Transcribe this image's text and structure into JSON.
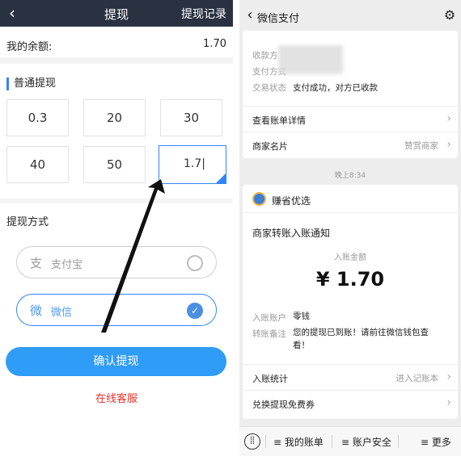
{
  "left": {
    "header": {
      "back_icon": "chevron-left-icon",
      "title": "提现",
      "records": "提现记录",
      "bg": "#2a3242"
    },
    "balance": {
      "label": "我的余额:",
      "value": "1.70"
    },
    "section_normal": "普通提现",
    "amounts": [
      "0.3",
      "20",
      "30",
      "40",
      "50"
    ],
    "custom_amount": "1.7",
    "method_title": "提现方式",
    "methods": [
      {
        "icon": "alipay-icon",
        "glyph": "支",
        "name": "支付宝",
        "selected": false
      },
      {
        "icon": "wechat-icon",
        "glyph": "微",
        "name": "微信",
        "selected": true
      }
    ],
    "confirm": "确认提现",
    "service": "在线客服",
    "accent": "#2f86f6",
    "service_color": "#e8302a"
  },
  "right": {
    "header": {
      "back_icon": "chevron-left-icon",
      "title": "微信支付",
      "gear_icon": "gear-icon"
    },
    "card1": {
      "rows": [
        {
          "label": "收款方",
          "value": ""
        },
        {
          "label": "支付方式",
          "value": ""
        },
        {
          "label": "交易状态",
          "value": "支付成功，对方已收款"
        }
      ],
      "bill_detail": "查看账单详情",
      "merchant_label": "商家名片",
      "merchant_value": "赞赏商家"
    },
    "time": "晚上8:34",
    "card2": {
      "brand": "赚省优选",
      "notice": "商家转账入账通知",
      "amount_label": "入账金额",
      "amount": "¥ 1.70",
      "account_label": "入账账户",
      "account_value": "零钱",
      "remark_label": "转账备注",
      "remark_value_line1": "您的提现已到账！请前往微信钱包查",
      "remark_value_line2": "看！",
      "stats_label": "入账统计",
      "stats_value": "进入记账本",
      "exchange_label": "兑换提现免费券"
    },
    "bottom": {
      "keyboard_icon": "keyboard-icon",
      "items": [
        "≡ 我的账单",
        "≡ 账户安全",
        "≡ 更多"
      ]
    }
  }
}
